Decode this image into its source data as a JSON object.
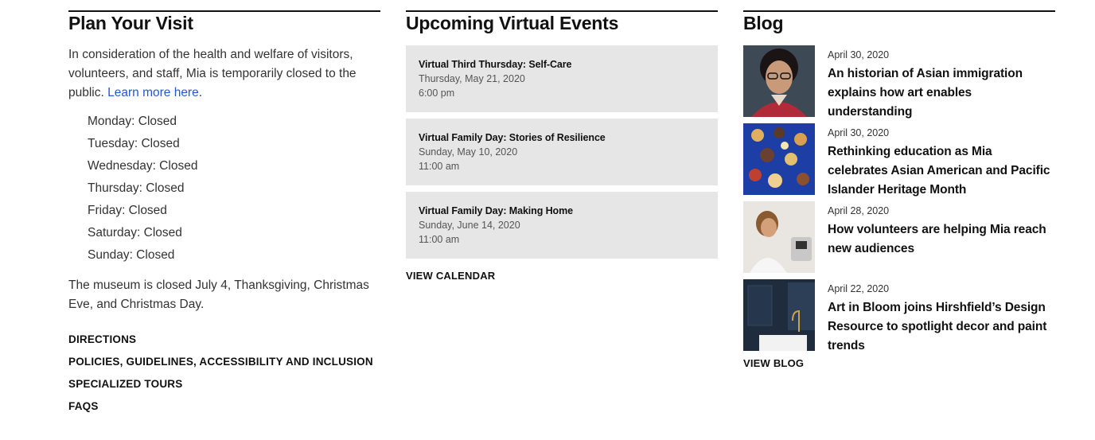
{
  "visit": {
    "title": "Plan Your Visit",
    "intro_text": "In consideration of the health and welfare of visitors, volunteers, and staff, Mia is temporarily closed to the public. ",
    "intro_link": "Learn more here",
    "intro_end": ".",
    "hours": [
      "Monday: Closed",
      "Tuesday: Closed",
      "Wednesday: Closed",
      "Thursday: Closed",
      "Friday: Closed",
      "Saturday: Closed",
      "Sunday: Closed"
    ],
    "closed_note": "The museum is closed July 4, Thanksgiving, Christmas Eve, and Christmas Day.",
    "links": [
      "DIRECTIONS",
      "POLICIES, GUIDELINES, ACCESSIBILITY AND INCLUSION",
      "SPECIALIZED TOURS",
      "FAQS"
    ]
  },
  "events": {
    "title": "Upcoming Virtual Events",
    "items": [
      {
        "title": "Virtual Third Thursday: Self-Care",
        "date": "Thursday, May 21, 2020",
        "time": "6:00 pm"
      },
      {
        "title": "Virtual Family Day: Stories of Resilience",
        "date": "Sunday, May 10, 2020",
        "time": "11:00 am"
      },
      {
        "title": "Virtual Family Day: Making Home",
        "date": "Sunday, June 14, 2020",
        "time": "11:00 am"
      }
    ],
    "view_label": "VIEW CALENDAR"
  },
  "blog": {
    "title": "Blog",
    "posts": [
      {
        "date": "April 30, 2020",
        "title": "An historian of Asian immigration explains how art enables understanding"
      },
      {
        "date": "April 30, 2020",
        "title": "Rethinking education as Mia celebrates Asian American and Pacific Islander Heritage Month"
      },
      {
        "date": "April 28, 2020",
        "title": "How volunteers are helping Mia reach new audiences"
      },
      {
        "date": "April 22, 2020",
        "title": "Art in Bloom joins Hirshfield’s Design Resource to spotlight decor and paint trends"
      }
    ],
    "view_label": "VIEW BLOG"
  }
}
